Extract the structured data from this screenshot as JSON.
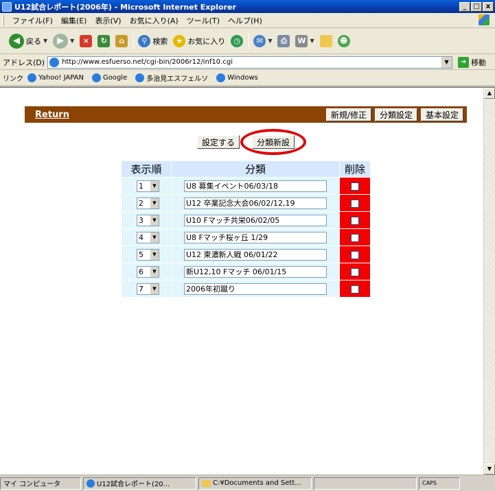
{
  "window": {
    "title": "U12試合レポート(2006年) - Microsoft Internet Explorer",
    "btn_min": "_",
    "btn_max": "□",
    "btn_close": "x"
  },
  "menu": [
    "ファイル(F)",
    "編集(E)",
    "表示(V)",
    "お気に入り(A)",
    "ツール(T)",
    "ヘルプ(H)"
  ],
  "toolbar": {
    "back": "戻る",
    "search": "検索",
    "favorites": "お気に入り"
  },
  "address": {
    "label": "アドレス(D)",
    "url": "http://www.esfuerso.net/cgi-bin/2006r12/inf10.cgi",
    "go": "移動"
  },
  "links": {
    "label": "リンク",
    "items": [
      "Yahoo! JAPAN",
      "Google",
      "多治見エスフェルソ",
      "Windows"
    ]
  },
  "page": {
    "return_link": "Return",
    "header_buttons": [
      "新規/修正",
      "分類設定",
      "基本設定"
    ],
    "set_button": "設定する",
    "new_category_button": "分類新設",
    "table": {
      "headers": {
        "order": "表示順",
        "category": "分類",
        "delete": "削除"
      },
      "rows": [
        {
          "order": "1",
          "category": "U8 募集イベント06/03/18"
        },
        {
          "order": "2",
          "category": "U12 卒業記念大会06/02/12,19"
        },
        {
          "order": "3",
          "category": "U10 Fマッチ共栄06/02/05"
        },
        {
          "order": "4",
          "category": "U8 Fマッチ桜ヶ丘 1/29"
        },
        {
          "order": "5",
          "category": "U12 東濃新人戦 06/01/22"
        },
        {
          "order": "6",
          "category": "新U12,10 Fマッチ 06/01/15"
        },
        {
          "order": "7",
          "category": "2006年初蹴り"
        }
      ]
    }
  },
  "statusbar": {
    "zone": "マイ コンピュータ",
    "task1": "U12試合レポート(20...",
    "task2": "C:¥Documents and Sett...",
    "caps": "CAPS"
  },
  "colors": {
    "header_bar": "#8b4306",
    "delete_cell": "#f00000",
    "highlight_ring": "#e00000"
  }
}
